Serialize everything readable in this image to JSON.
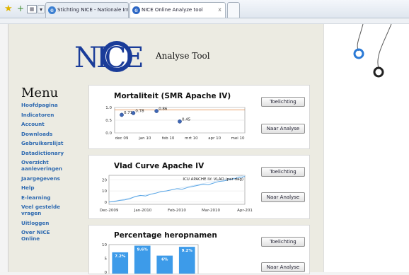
{
  "browser": {
    "tabs": [
      {
        "label": "Stichting NICE - Nationale Int..."
      },
      {
        "label": "NICE Online Analyze tool",
        "close": "x"
      }
    ],
    "add_label": "+",
    "drop_label": "▾"
  },
  "header": {
    "logo_text": "NICE",
    "tool_title": "Analyse Tool"
  },
  "menu": {
    "title": "Menu",
    "items": [
      {
        "label": "Hoofdpagina"
      },
      {
        "label": "Indicatoren"
      },
      {
        "label": "Account"
      },
      {
        "label": "Downloads"
      },
      {
        "label": "Gebruikerslijst"
      },
      {
        "label": "Datadictionary"
      },
      {
        "label": "Overzicht aanleveringen"
      },
      {
        "label": "Jaargegevens"
      },
      {
        "label": "Help"
      },
      {
        "label": "E-learning"
      },
      {
        "label": "Veel gestelde vragen"
      },
      {
        "label": "Uitloggen"
      },
      {
        "label": "Over NICE Online"
      }
    ]
  },
  "cards": [
    {
      "title": "Mortaliteit (SMR Apache IV)",
      "explain_label": "Toelichting",
      "analysis_label": "Naar Analyse",
      "chart_data": {
        "type": "scatter",
        "categories": [
          "dec 09",
          "jan 10",
          "feb 10",
          "mrt 10",
          "apr 10",
          "mei 10"
        ],
        "y_ticks": [
          "1.0",
          "0.5",
          "0.0"
        ],
        "ylim": [
          0,
          1.0
        ],
        "reference_line": 0.9,
        "points": [
          {
            "category": "dec 09",
            "value": 0.71,
            "label": "0.71"
          },
          {
            "category": "jan 10",
            "value": 0.78,
            "label": "0.78"
          },
          {
            "category": "feb 10",
            "value": 0.86,
            "label": "0.86"
          },
          {
            "category": "mrt 10",
            "value": 0.45,
            "label": "0.45"
          }
        ]
      }
    },
    {
      "title": "Vlad Curve Apache IV",
      "explain_label": "Toelichting",
      "analysis_label": "Naar Analyse",
      "chart_data": {
        "type": "line",
        "legend": "ICU  APACHE IV: VLAD (per dag)",
        "x_ticks": [
          "Dec-2009",
          "Jan-2010",
          "Feb-2010",
          "Mar-2010",
          "Apr-201"
        ],
        "y_ticks": [
          "20",
          "10",
          "0"
        ],
        "ylim": [
          -2,
          24
        ],
        "series": [
          {
            "values": [
              0,
              0.5,
              1.5,
              2,
              3,
              5,
              6,
              5.5,
              7,
              8,
              9.5,
              10,
              11,
              12,
              11.5,
              13,
              14,
              15,
              16,
              15.5,
              17,
              18.5,
              19,
              20,
              21,
              22,
              23
            ]
          }
        ],
        "ref_values": [
          0,
          1.2,
          2.4,
          3.6,
          4.8,
          6,
          7.2,
          8.4,
          9.6,
          10.8,
          12,
          13.2,
          14.4,
          15.6,
          16.8,
          18,
          19.2,
          20.4,
          21.6,
          22.8,
          24
        ]
      }
    },
    {
      "title": "Percentage heropnamen",
      "explain_label": "Toelichting",
      "analysis_label": "Naar Analyse",
      "chart_data": {
        "type": "bar",
        "y_ticks": [
          "10",
          "5",
          "0"
        ],
        "ylim": [
          0,
          10
        ],
        "values": [
          7.2,
          9.6,
          6,
          9.2
        ],
        "labels": [
          "7.2%",
          "9.6%",
          "6%",
          "9.2%"
        ]
      }
    }
  ],
  "colors": {
    "accent": "#2f6ab0",
    "bar": "#3d9be9",
    "ref_line": "#e0843a",
    "point": "#3f67b5"
  }
}
